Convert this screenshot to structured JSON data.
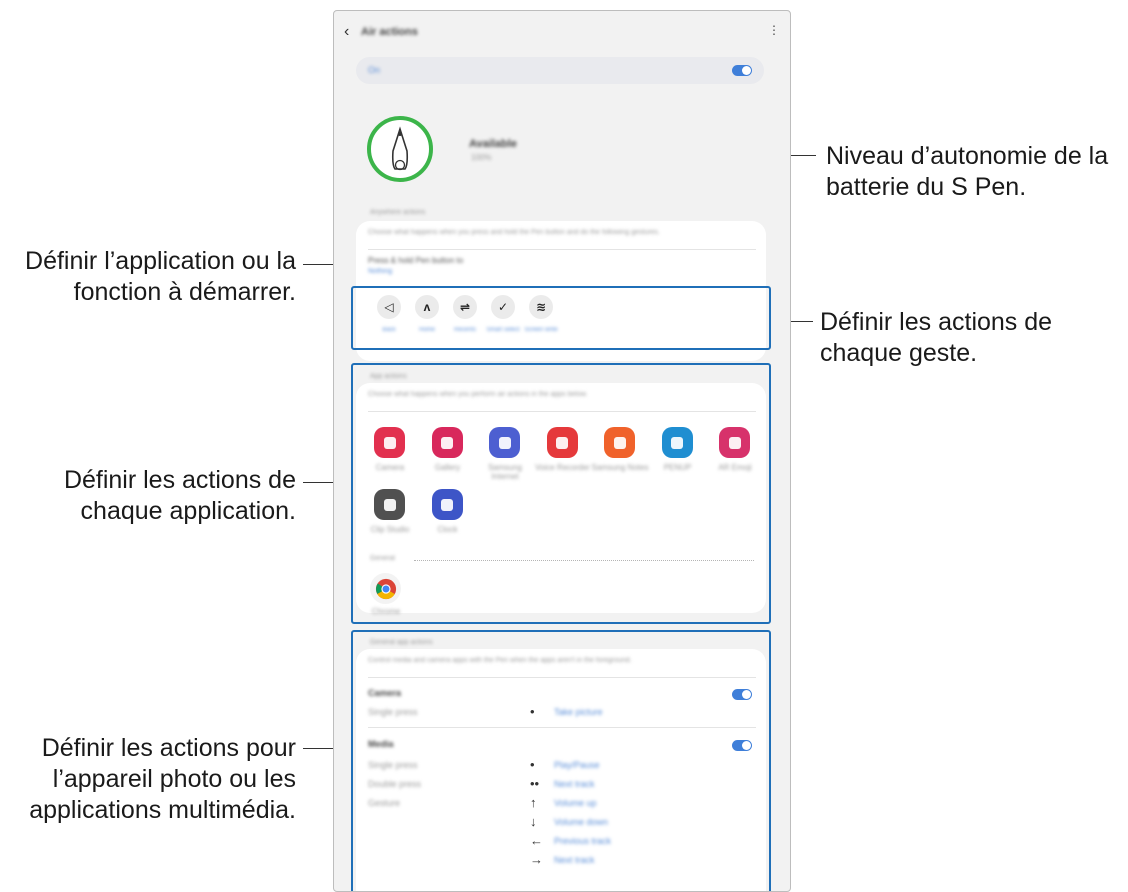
{
  "callouts": {
    "battery_line1": "Niveau d’autonomie de la",
    "battery_line2": "batterie du S Pen.",
    "set_app_line1": "Définir l’application ou la",
    "set_app_line2": "fonction à démarrer.",
    "gesture_line1": "Définir les actions de",
    "gesture_line2": "chaque geste.",
    "app_actions_line1": "Définir les actions de",
    "app_actions_line2": "chaque application.",
    "camera_line1": "Définir les actions pour",
    "camera_line2": "l’appareil photo ou les",
    "camera_line3": "applications multimédia."
  },
  "screen": {
    "header": {
      "title": "Air actions"
    },
    "master": {
      "label": "On"
    },
    "pen": {
      "status": "Available",
      "battery": "100%"
    },
    "anywhere": {
      "section": "Anywhere actions",
      "description": "Choose what happens when you press and hold the Pen button and do the following gestures.",
      "press_hold": "Press & hold Pen button to",
      "press_hold_value": "Nothing",
      "gestures": [
        {
          "symbol": "◁",
          "label": "Back"
        },
        {
          "symbol": "ʌ",
          "label": "Home"
        },
        {
          "symbol": "⇌",
          "label": "Recents"
        },
        {
          "symbol": "✓",
          "label": "Smart select"
        },
        {
          "symbol": "≋",
          "label": "Screen write"
        }
      ]
    },
    "app_actions": {
      "section": "App actions",
      "description": "Choose what happens when you perform air actions in the apps below.",
      "apps": [
        {
          "label": "Camera",
          "color": "#e2304f",
          "icon": "camera-app-icon"
        },
        {
          "label": "Gallery",
          "color": "#d8285c",
          "icon": "gallery-app-icon"
        },
        {
          "label": "Samsung Internet",
          "color": "#4d5fd1",
          "icon": "internet-app-icon"
        },
        {
          "label": "Voice Recorder",
          "color": "#e5393b",
          "icon": "voice-recorder-app-icon"
        },
        {
          "label": "Samsung Notes",
          "color": "#f0622b",
          "icon": "notes-app-icon"
        },
        {
          "label": "PENUP",
          "color": "#1f8ed1",
          "icon": "penup-app-icon"
        },
        {
          "label": "AR Emoji",
          "color": "#d7326b",
          "icon": "ar-emoji-app-icon"
        },
        {
          "label": "Clip Studio",
          "color": "#505050",
          "icon": "clip-studio-app-icon"
        },
        {
          "label": "Clock",
          "color": "#3d55c7",
          "icon": "clock-app-icon"
        }
      ],
      "general_label": "General",
      "general_app": {
        "label": "Chrome",
        "icon": "chrome-app-icon"
      }
    },
    "general_actions": {
      "section": "General app actions",
      "description": "Control media and camera apps with the Pen when the apps aren't in the foreground.",
      "camera": {
        "title": "Camera",
        "rows": [
          {
            "label": "Single press",
            "symbol": "•",
            "action": "Take picture"
          }
        ]
      },
      "media": {
        "title": "Media",
        "rows": [
          {
            "label": "Single press",
            "symbol": "•",
            "action": "Play/Pause"
          },
          {
            "label": "Double press",
            "symbol": "••",
            "action": "Next track"
          },
          {
            "label": "Gesture",
            "symbol": "↑",
            "action": "Volume up"
          },
          {
            "label": "",
            "symbol": "↓",
            "action": "Volume down"
          },
          {
            "label": "",
            "symbol": "←",
            "action": "Previous track"
          },
          {
            "label": "",
            "symbol": "→",
            "action": "Next track"
          }
        ]
      }
    }
  }
}
